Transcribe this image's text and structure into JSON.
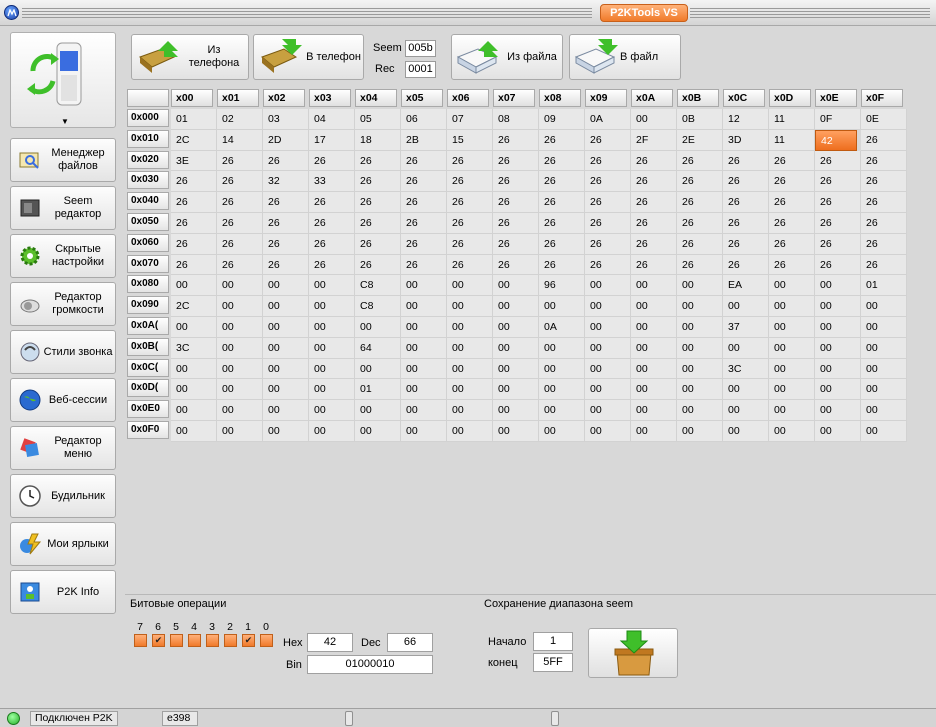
{
  "app": {
    "title": "P2KTools VS"
  },
  "sidebar": {
    "items": [
      {
        "label": "Менеджер файлов",
        "icon": "file-manager-icon"
      },
      {
        "label": "Seem редактор",
        "icon": "seem-editor-icon"
      },
      {
        "label": "Скрытые настройки",
        "icon": "gear-icon"
      },
      {
        "label": "Редактор громкости",
        "icon": "speaker-icon"
      },
      {
        "label": "Стили звонка",
        "icon": "ringtone-icon"
      },
      {
        "label": "Веб-сессии",
        "icon": "globe-icon"
      },
      {
        "label": "Редактор меню",
        "icon": "menu-editor-icon"
      },
      {
        "label": "Будильник",
        "icon": "clock-icon"
      },
      {
        "label": "Мои ярлыки",
        "icon": "shortcuts-icon"
      },
      {
        "label": "P2K Info",
        "icon": "info-icon"
      }
    ]
  },
  "toolbar": {
    "from_phone": "Из телефона",
    "to_phone": "В телефон",
    "seem_label": "Seem",
    "seem_value": "005b",
    "rec_label": "Rec",
    "rec_value": "0001",
    "from_file": "Из файла",
    "to_file": "В файл"
  },
  "grid": {
    "columns": [
      "x00",
      "x01",
      "x02",
      "x03",
      "x04",
      "x05",
      "x06",
      "x07",
      "x08",
      "x09",
      "x0A",
      "x0B",
      "x0C",
      "x0D",
      "x0E",
      "x0F"
    ],
    "rows": [
      {
        "addr": "0x000",
        "values": [
          "01",
          "02",
          "03",
          "04",
          "05",
          "06",
          "07",
          "08",
          "09",
          "0A",
          "00",
          "0B",
          "12",
          "11",
          "0F",
          "0E"
        ]
      },
      {
        "addr": "0x010",
        "values": [
          "2C",
          "14",
          "2D",
          "17",
          "18",
          "2B",
          "15",
          "26",
          "26",
          "26",
          "2F",
          "2E",
          "3D",
          "11",
          "42",
          "26"
        ]
      },
      {
        "addr": "0x020",
        "values": [
          "3E",
          "26",
          "26",
          "26",
          "26",
          "26",
          "26",
          "26",
          "26",
          "26",
          "26",
          "26",
          "26",
          "26",
          "26",
          "26"
        ]
      },
      {
        "addr": "0x030",
        "values": [
          "26",
          "26",
          "32",
          "33",
          "26",
          "26",
          "26",
          "26",
          "26",
          "26",
          "26",
          "26",
          "26",
          "26",
          "26",
          "26"
        ]
      },
      {
        "addr": "0x040",
        "values": [
          "26",
          "26",
          "26",
          "26",
          "26",
          "26",
          "26",
          "26",
          "26",
          "26",
          "26",
          "26",
          "26",
          "26",
          "26",
          "26"
        ]
      },
      {
        "addr": "0x050",
        "values": [
          "26",
          "26",
          "26",
          "26",
          "26",
          "26",
          "26",
          "26",
          "26",
          "26",
          "26",
          "26",
          "26",
          "26",
          "26",
          "26"
        ]
      },
      {
        "addr": "0x060",
        "values": [
          "26",
          "26",
          "26",
          "26",
          "26",
          "26",
          "26",
          "26",
          "26",
          "26",
          "26",
          "26",
          "26",
          "26",
          "26",
          "26"
        ]
      },
      {
        "addr": "0x070",
        "values": [
          "26",
          "26",
          "26",
          "26",
          "26",
          "26",
          "26",
          "26",
          "26",
          "26",
          "26",
          "26",
          "26",
          "26",
          "26",
          "26"
        ]
      },
      {
        "addr": "0x080",
        "values": [
          "00",
          "00",
          "00",
          "00",
          "C8",
          "00",
          "00",
          "00",
          "96",
          "00",
          "00",
          "00",
          "EA",
          "00",
          "00",
          "01"
        ]
      },
      {
        "addr": "0x090",
        "values": [
          "2C",
          "00",
          "00",
          "00",
          "C8",
          "00",
          "00",
          "00",
          "00",
          "00",
          "00",
          "00",
          "00",
          "00",
          "00",
          "00"
        ]
      },
      {
        "addr": "0x0A(",
        "values": [
          "00",
          "00",
          "00",
          "00",
          "00",
          "00",
          "00",
          "00",
          "0A",
          "00",
          "00",
          "00",
          "37",
          "00",
          "00",
          "00"
        ]
      },
      {
        "addr": "0x0B(",
        "values": [
          "3C",
          "00",
          "00",
          "00",
          "64",
          "00",
          "00",
          "00",
          "00",
          "00",
          "00",
          "00",
          "00",
          "00",
          "00",
          "00"
        ]
      },
      {
        "addr": "0x0C(",
        "values": [
          "00",
          "00",
          "00",
          "00",
          "00",
          "00",
          "00",
          "00",
          "00",
          "00",
          "00",
          "00",
          "3C",
          "00",
          "00",
          "00"
        ]
      },
      {
        "addr": "0x0D(",
        "values": [
          "00",
          "00",
          "00",
          "00",
          "01",
          "00",
          "00",
          "00",
          "00",
          "00",
          "00",
          "00",
          "00",
          "00",
          "00",
          "00"
        ]
      },
      {
        "addr": "0x0E0",
        "values": [
          "00",
          "00",
          "00",
          "00",
          "00",
          "00",
          "00",
          "00",
          "00",
          "00",
          "00",
          "00",
          "00",
          "00",
          "00",
          "00"
        ]
      },
      {
        "addr": "0x0F0",
        "values": [
          "00",
          "00",
          "00",
          "00",
          "00",
          "00",
          "00",
          "00",
          "00",
          "00",
          "00",
          "00",
          "00",
          "00",
          "00",
          "00"
        ]
      }
    ],
    "selected": {
      "row": 1,
      "col": 14
    }
  },
  "bits": {
    "section_label": "Битовые операции",
    "labels": [
      "7",
      "6",
      "5",
      "4",
      "3",
      "2",
      "1",
      "0"
    ],
    "checked": [
      false,
      true,
      false,
      false,
      false,
      false,
      true,
      false
    ],
    "hex_label": "Hex",
    "hex_value": "42",
    "dec_label": "Dec",
    "dec_value": "66",
    "bin_label": "Bin",
    "bin_value": "01000010"
  },
  "range": {
    "section_label": "Сохранение диапазона seem",
    "start_label": "Начало",
    "start_value": "1",
    "end_label": "конец",
    "end_value": "5FF"
  },
  "status": {
    "connection": "Подключен P2K",
    "model": "e398"
  }
}
